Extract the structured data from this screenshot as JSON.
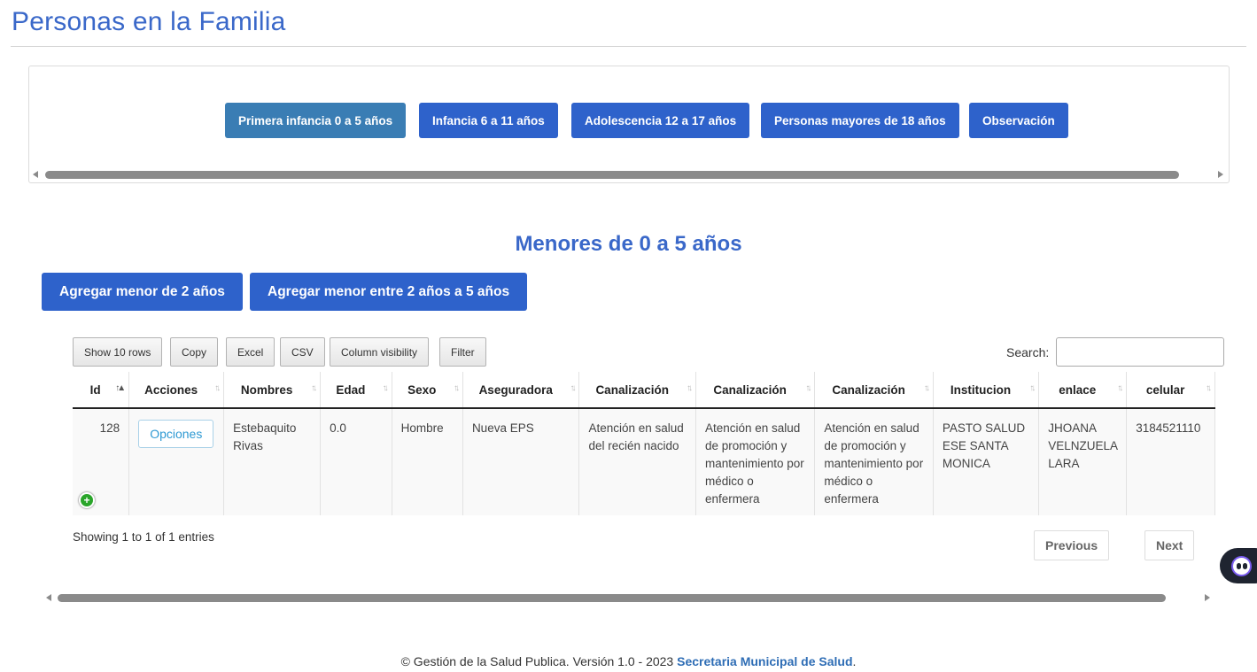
{
  "page": {
    "title": "Personas en la Familia"
  },
  "tabs": [
    {
      "label": "Primera infancia 0 a 5 años",
      "active": true
    },
    {
      "label": "Infancia 6 a 11 años",
      "active": false
    },
    {
      "label": "Adolescencia 12 a 17 años",
      "active": false
    },
    {
      "label": "Personas mayores de 18 años",
      "active": false
    },
    {
      "label": "Observación",
      "active": false
    }
  ],
  "section": {
    "title": "Menores de 0 a 5 años",
    "add_under2_label": "Agregar menor de 2 años",
    "add_2to5_label": "Agregar menor entre 2 años a 5 años"
  },
  "toolbar": {
    "show_rows": "Show 10 rows",
    "copy": "Copy",
    "excel": "Excel",
    "csv": "CSV",
    "column_visibility": "Column visibility",
    "filter": "Filter",
    "search_label": "Search:",
    "search_value": ""
  },
  "table": {
    "columns": [
      "Id",
      "Acciones",
      "Nombres",
      "Edad",
      "Sexo",
      "Aseguradora",
      "Canalización",
      "Canalización",
      "Canalización",
      "Institucion",
      "enlace",
      "celular"
    ],
    "sorted_column": "Id",
    "rows": [
      {
        "id": "128",
        "acciones": "Opciones",
        "nombres": "Estebaquito Rivas",
        "edad": "0.0",
        "sexo": "Hombre",
        "aseguradora": "Nueva EPS",
        "canalizacion_1": "Atención en salud del recién nacido",
        "canalizacion_2": "Atención en salud de promoción y mantenimiento por médico o enfermera",
        "canalizacion_3": "Atención en salud de promoción y mantenimiento por médico o enfermera",
        "institucion": "PASTO SALUD ESE SANTA MONICA",
        "enlace": "JHOANA VELNZUELA LARA",
        "celular": "3184521110"
      }
    ]
  },
  "pagination": {
    "info": "Showing 1 to 1 of 1 entries",
    "previous": "Previous",
    "next": "Next"
  },
  "footer": {
    "text": "© Gestión de la Salud Publica. Versión 1.0 - 2023",
    "link": "Secretaria Municipal de Salud",
    "suffix": "."
  },
  "icons": {
    "sort_asc": "sort-asc-icon",
    "sort_both": "sort-both-icon",
    "expand": "plus-circle-icon",
    "assistant": "chatbot-icon"
  },
  "colors": {
    "primary": "#2e62cb",
    "active_tab": "#3a7db4",
    "title": "#3a68c9",
    "expand": "#2aa52a"
  }
}
